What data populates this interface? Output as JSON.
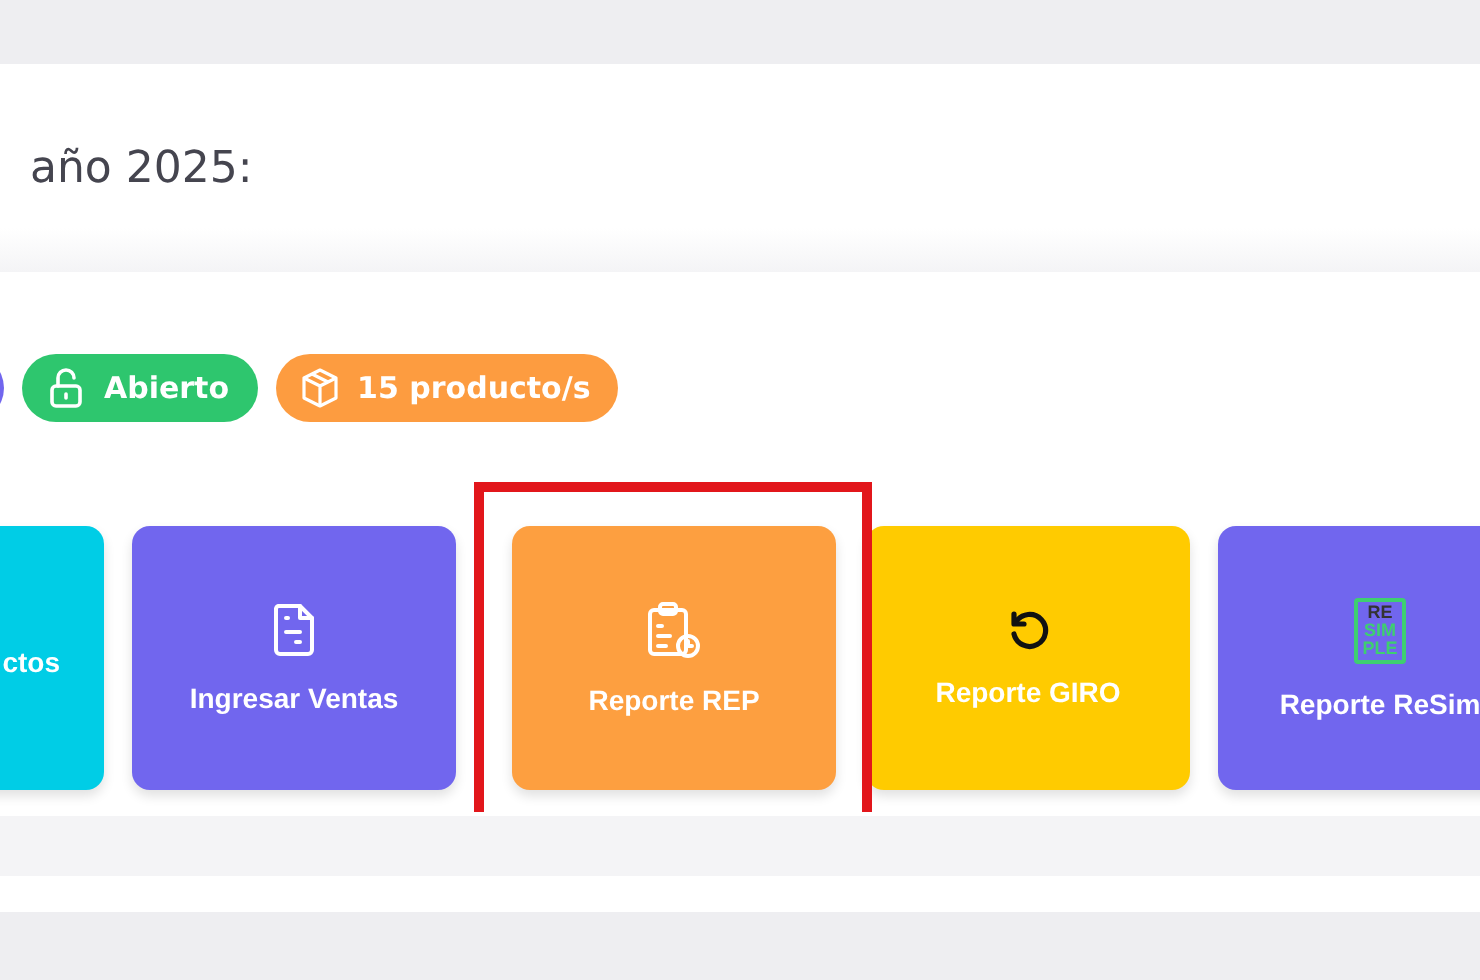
{
  "heading": "año 2025:",
  "badges": [
    {
      "kind": "blank",
      "color": "#7166ee"
    },
    {
      "kind": "lock",
      "label": "Abierto",
      "color": "#2ec66e"
    },
    {
      "kind": "box",
      "label": "15 producto/s",
      "color": "#fd9c40"
    }
  ],
  "tiles": [
    {
      "kind": "none",
      "label": "ctos",
      "color": "#00cde6",
      "highlighted": false
    },
    {
      "kind": "document",
      "label": "Ingresar Ventas",
      "color": "#7166ee",
      "highlighted": false
    },
    {
      "kind": "clipboard",
      "label": "Reporte REP",
      "color": "#fd9f40",
      "highlighted": true
    },
    {
      "kind": "undo",
      "label": "Reporte GIRO",
      "color": "#ffcb00",
      "highlighted": false
    },
    {
      "kind": "logo",
      "label": "Reporte ReSim",
      "color": "#7166ee",
      "highlighted": false,
      "logo_lines": [
        "RE",
        "SIM",
        "PLE"
      ]
    }
  ]
}
